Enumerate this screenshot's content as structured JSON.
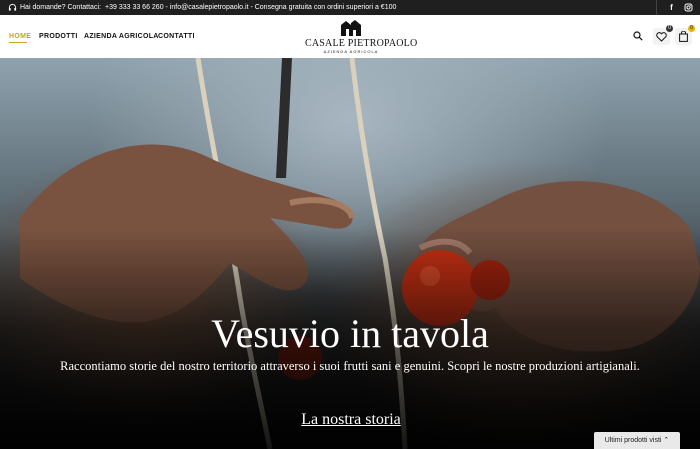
{
  "topbar": {
    "question": "Hai domande? Contattaci:",
    "contacts": "+39 333 33 66 260 - info@casalepietropaolo.it - Consegna gratuita con ordini superiori a €100",
    "facebook": "f",
    "icons": [
      "headset-icon",
      "facebook-icon",
      "instagram-icon"
    ]
  },
  "nav": {
    "home": "HOME",
    "prodotti": "PRODOTTI",
    "azienda": "AZIENDA AGRICOLA",
    "contatti": "CONTATTI"
  },
  "logo": {
    "brand": "CASALE PIETROPAOLO",
    "sub": "AZIENDA AGRICOLA"
  },
  "header_icons": {
    "wishlist_count": "0",
    "cart_count": "0",
    "icons": [
      "search-icon",
      "heart-icon",
      "cart-icon"
    ]
  },
  "hero": {
    "title": "Vesuvio in tavola",
    "subtitle": "Raccontiamo storie del nostro territorio attraverso i suoi frutti sani e genuini. Scopri le nostre produzioni artigianali.",
    "cta": "La nostra storia"
  },
  "recent": {
    "label": "Ultimi prodotti visti ⌃"
  },
  "colors": {
    "topbar": "#1f1f1f",
    "accent": "#c9a227",
    "text": "#111111"
  }
}
